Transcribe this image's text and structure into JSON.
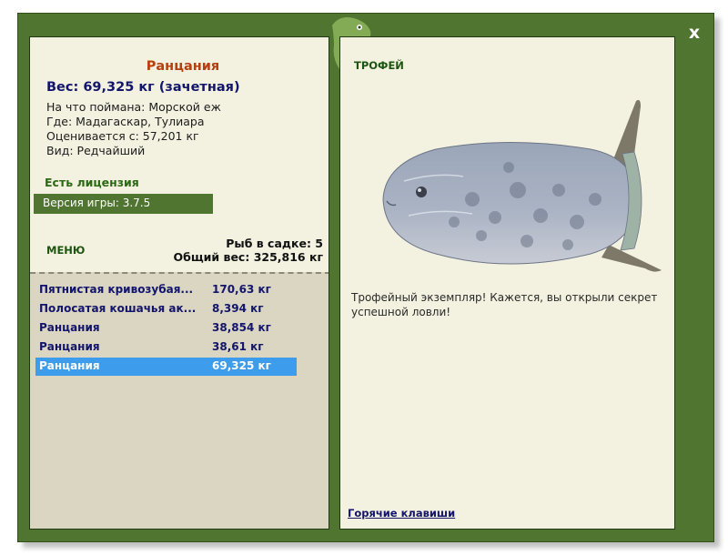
{
  "window": {
    "close_label": "x",
    "logo_icon": "chameleon-logo-icon"
  },
  "fish": {
    "name": "Ранцания",
    "weight": "Вес: 69,325 кг (зачетная)",
    "bait": "На что поймана: Морской еж",
    "location": "Где: Мадагаскар, Тулиара",
    "value": "Оценивается с: 57,201 кг",
    "rarity": "Вид: Редчайший"
  },
  "license": "Есть лицензия",
  "version": "Версия игры: 3.7.5",
  "menu_label": "МЕНЮ",
  "cage": {
    "count": "Рыб в садке: 5",
    "total": "Общий вес: 325,816 кг",
    "rows": [
      {
        "name": "Пятнистая кривозубая...",
        "weight": "170,63 кг"
      },
      {
        "name": "Полосатая кошачья ак...",
        "weight": "8,394 кг"
      },
      {
        "name": "Ранцания",
        "weight": "38,854 кг"
      },
      {
        "name": "Ранцания",
        "weight": "38,61 кг"
      },
      {
        "name": "Ранцания",
        "weight": "69,325 кг"
      }
    ],
    "selected_index": 4
  },
  "trophy": {
    "title": "ТРОФЕЙ",
    "text": "Трофейный экземпляр! Кажется, вы открыли секрет успешной ловли!",
    "image_icon": "sunfish-trophy-image"
  },
  "hotkeys_label": "Горячие клавиши",
  "colors": {
    "frame_green": "#4f7530",
    "panel_bg": "#f3f1df",
    "cage_bg": "#dbd6c2",
    "selected_row": "#3d9ceb",
    "fish_name": "#b5400f",
    "navy_text": "#12156b",
    "license_green": "#2b6a14"
  }
}
